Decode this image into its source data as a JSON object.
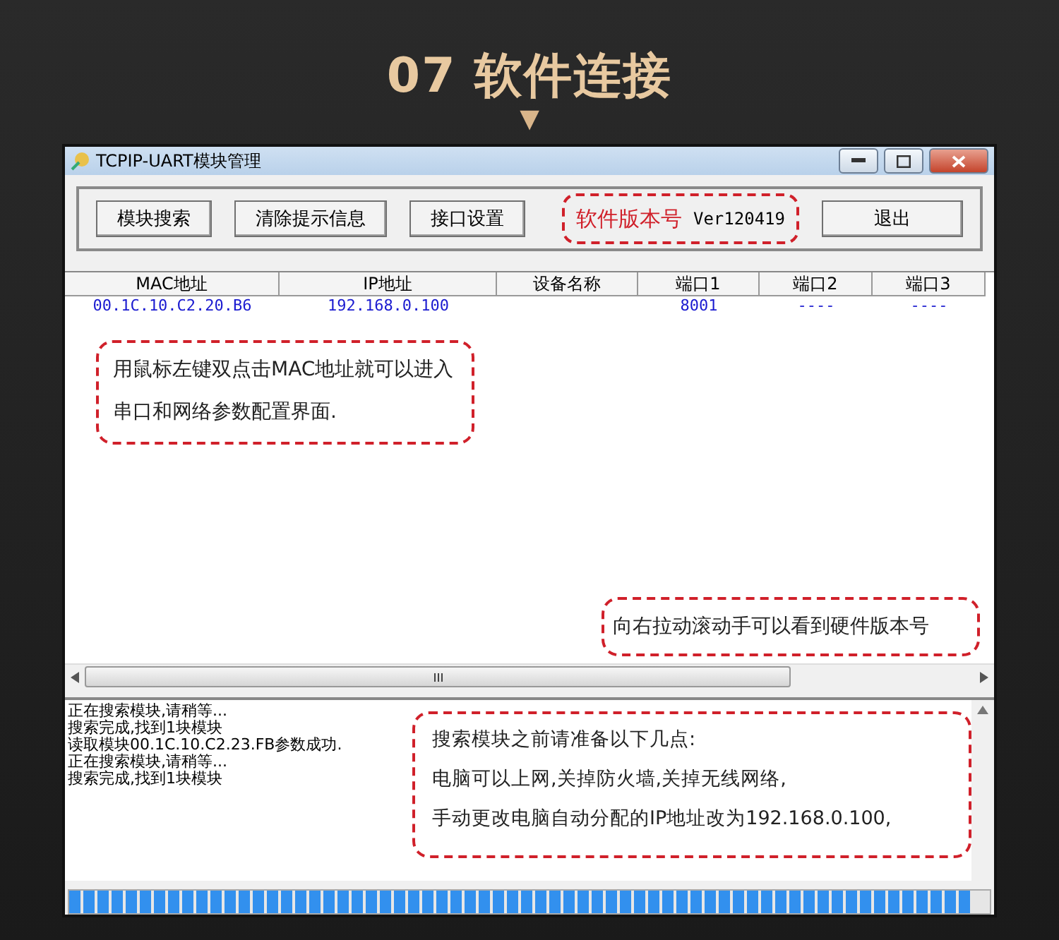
{
  "page_title": "07 软件连接",
  "marker": "▼",
  "window": {
    "title": "TCPIP-UART模块管理"
  },
  "toolbar": {
    "buttons": [
      "模块搜索",
      "清除提示信息",
      "接口设置"
    ],
    "version_label": "软件版本号",
    "version": "Ver120419",
    "exit_button": "退出"
  },
  "table": {
    "columns": [
      "MAC地址",
      "IP地址",
      "设备名称",
      "端口1",
      "端口2",
      "端口3"
    ],
    "rows": [
      {
        "cells": [
          "00.1C.10.C2.20.B6",
          "192.168.0.100",
          "",
          "8001",
          "----",
          "----"
        ]
      }
    ]
  },
  "table_note": "用鼠标左键双点击MAC地址就可以进入串口和网络参数配置界面.",
  "scroll_note": "向右拉动滚动手可以看到硬件版本号",
  "log": {
    "lines": [
      "正在搜索模块,请稍等...",
      "搜索完成,找到1块模块",
      "读取模块00.1C.10.C2.23.FB参数成功.",
      "正在搜索模块,请稍等...",
      "搜索完成,找到1块模块"
    ]
  },
  "log_note": {
    "lines": [
      "搜索模块之前请准备以下几点:",
      "电脑可以上网,关掉防火墙,关掉无线网络,",
      "手动更改电脑自动分配的IP地址改为192.168.0.100,"
    ]
  },
  "progress": {
    "level": 0.98
  }
}
